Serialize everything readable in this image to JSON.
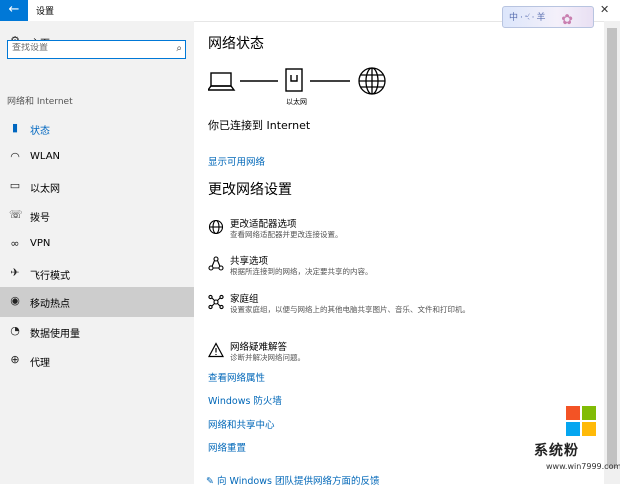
{
  "window": {
    "title": "设置",
    "back_glyph": "←",
    "close_glyph": "✕",
    "deco_text": "中·ৼ·羊"
  },
  "sidebar": {
    "home": "主页",
    "search_placeholder": "查找设置",
    "section": "网络和 Internet",
    "items": [
      {
        "label": "状态",
        "icon": "status-icon",
        "active": true
      },
      {
        "label": "WLAN",
        "icon": "wifi-icon"
      },
      {
        "label": "以太网",
        "icon": "ethernet-icon"
      },
      {
        "label": "拨号",
        "icon": "dialup-icon"
      },
      {
        "label": "VPN",
        "icon": "vpn-icon"
      },
      {
        "label": "飞行模式",
        "icon": "airplane-icon"
      },
      {
        "label": "移动热点",
        "icon": "hotspot-icon",
        "highlighted": true
      },
      {
        "label": "数据使用量",
        "icon": "data-usage-icon"
      },
      {
        "label": "代理",
        "icon": "proxy-icon"
      }
    ]
  },
  "main": {
    "status_title": "网络状态",
    "ethernet_caption": "以太网",
    "connected_text": "你已连接到 Internet",
    "show_networks": "显示可用网络",
    "change_title": "更改网络设置",
    "options": [
      {
        "title": "更改适配器选项",
        "desc": "查看网络适配器并更改连接设置。",
        "icon": "adapter-icon"
      },
      {
        "title": "共享选项",
        "desc": "根据所连接到的网络，决定要共享的内容。",
        "icon": "sharing-icon"
      },
      {
        "title": "家庭组",
        "desc": "设置家庭组，以便与网络上的其他电脑共享图片、音乐、文件和打印机。",
        "icon": "homegroup-icon"
      },
      {
        "title": "网络疑难解答",
        "desc": "诊断并解决网络问题。",
        "icon": "troubleshoot-icon"
      }
    ],
    "links": [
      "查看网络属性",
      "Windows 防火墙",
      "网络和共享中心",
      "网络重置"
    ],
    "feedback": "向 Windows 团队提供网络方面的反馈"
  },
  "watermark": {
    "text": "系统粉",
    "url": "www.win7999.com",
    "colors": [
      "#f35325",
      "#81bc06",
      "#05a6f0",
      "#ffba08"
    ]
  }
}
